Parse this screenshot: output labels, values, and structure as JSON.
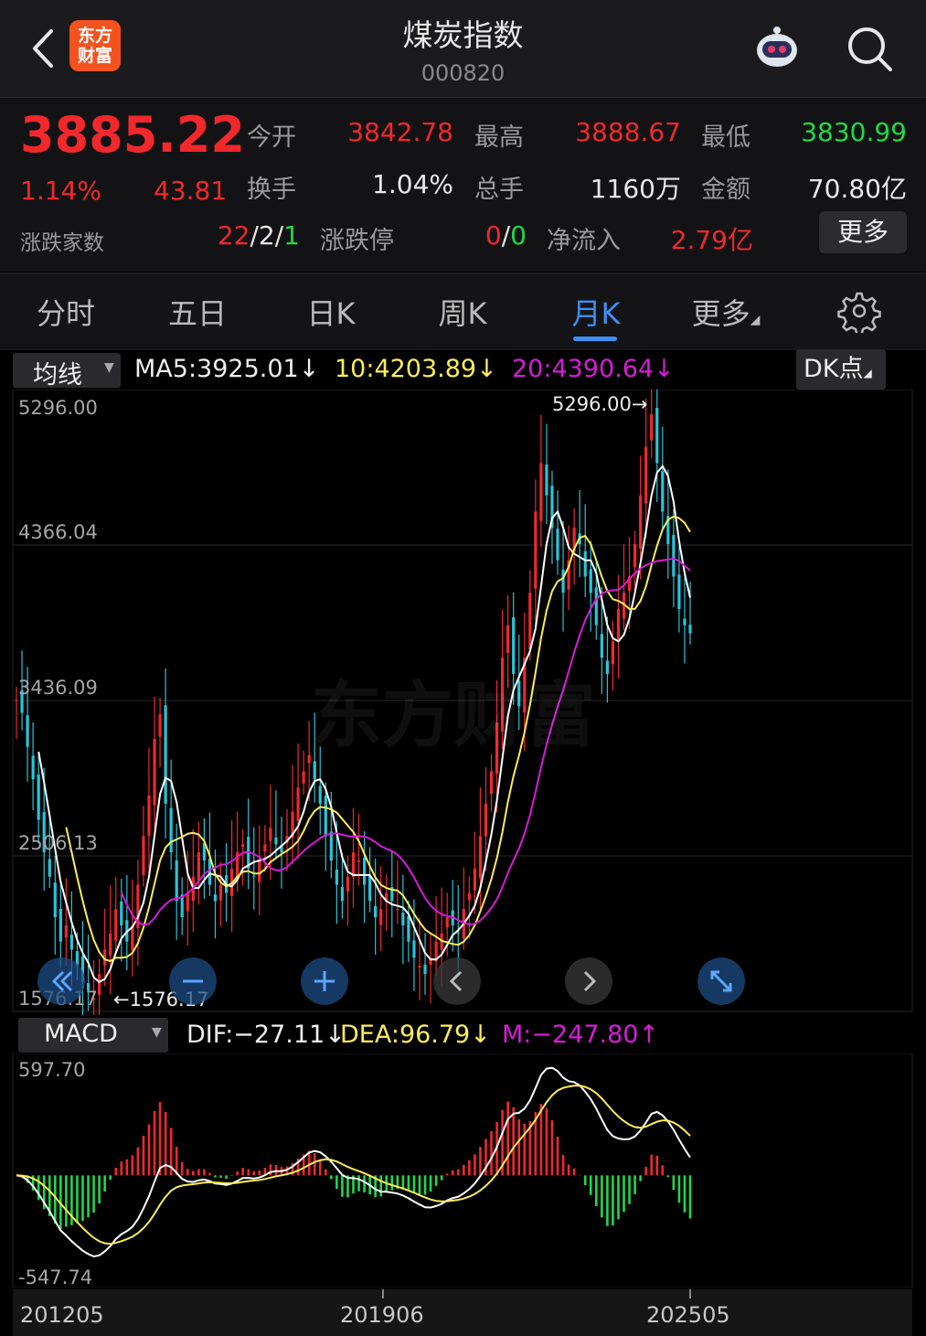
{
  "header": {
    "back_icon": "back-chevron-icon",
    "logo_text_line1": "东方",
    "logo_text_line2": "财富",
    "title": "煤炭指数",
    "code": "000820"
  },
  "quote": {
    "price": "3885.22",
    "change_pct": "1.14%",
    "change": "43.81",
    "open_label": "今开",
    "open": "3842.78",
    "high_label": "最高",
    "high": "3888.67",
    "low_label": "最低",
    "low": "3830.99",
    "turnover_label": "换手",
    "turnover": "1.04%",
    "volume_label": "总手",
    "volume": "1160万",
    "amount_label": "金额",
    "amount": "70.80亿",
    "advdec_label": "涨跌家数",
    "adv": "22",
    "flat": "2",
    "dec": "1",
    "slash": "/",
    "limit_label": "涨跌停",
    "limit_up": "0",
    "limit_down": "0",
    "netflow_label": "净流入",
    "netflow": "2.79亿",
    "more_label": "更多"
  },
  "tabs": {
    "items": [
      "分时",
      "五日",
      "日K",
      "周K",
      "月K",
      "更多"
    ],
    "active": "月K",
    "settings_icon": "gear-icon"
  },
  "kline": {
    "indicator_select": "均线",
    "ma5": "MA5:3925.01↓",
    "ma10": "10:4203.89↓",
    "ma20": "20:4390.64↓",
    "dk_label": "DK点",
    "y_ticks": [
      "5296.00",
      "4366.04",
      "3436.09",
      "2506.13",
      "1576.17"
    ],
    "max_label": "5296.00→",
    "min_label": "←1576.17",
    "watermark": "东方财富",
    "colors": {
      "up": "#f2282c",
      "down": "#26c6da",
      "ma5": "#ffffff",
      "ma10": "#ffee58",
      "ma20": "#d81bd8"
    }
  },
  "controls": {
    "icons": [
      "double-left-icon",
      "zoom-out-icon",
      "zoom-in-icon",
      "scroll-left-icon",
      "scroll-right-icon",
      "fullscreen-icon"
    ]
  },
  "macd": {
    "indicator_select": "MACD",
    "dif": "DIF:−27.11↓",
    "dea": "DEA:96.79↓",
    "m": "M:−247.80↑",
    "y_top": "597.70",
    "y_bottom": "-547.74"
  },
  "x_ticks": [
    "201205",
    "201906",
    "202505"
  ],
  "chart_data": {
    "type": "candlestick",
    "ylim": [
      1576.17,
      5296.0
    ],
    "macd_ylim": [
      -547.74,
      597.7
    ],
    "max": 5296.0,
    "min": 1576.17,
    "ma_last": {
      "ma5": 3925.01,
      "ma10": 4203.89,
      "ma20": 4390.64
    },
    "macd_last": {
      "dif": -27.11,
      "dea": 96.79,
      "m": -247.8
    }
  }
}
